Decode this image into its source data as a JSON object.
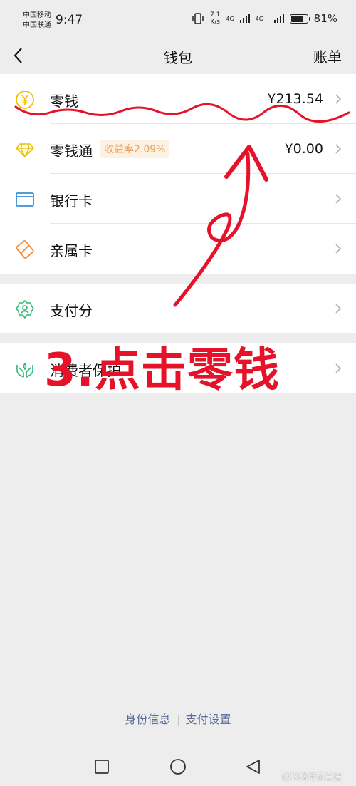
{
  "status_bar": {
    "carrier1": "中国移动",
    "carrier2": "中国联通",
    "time": "9:47",
    "speed_value": "7.1",
    "speed_unit": "K/s",
    "net1": "4G",
    "net2": "4G+",
    "battery": "81%",
    "battery_level": 0.81
  },
  "nav": {
    "back_icon": "chevron-left-icon",
    "title": "钱包",
    "right": "账单"
  },
  "groups": [
    {
      "items": [
        {
          "label": "零钱",
          "value": "¥213.54",
          "icon": "yuan-coin-icon"
        },
        {
          "label": "零钱通",
          "badge": "收益率2.09%",
          "value": "¥0.00",
          "icon": "diamond-icon"
        },
        {
          "label": "银行卡",
          "icon": "bank-card-icon"
        },
        {
          "label": "亲属卡",
          "icon": "family-card-icon"
        }
      ]
    },
    {
      "items": [
        {
          "label": "支付分",
          "icon": "badge-person-icon"
        }
      ]
    },
    {
      "items": [
        {
          "label": "消费者保护",
          "icon": "hands-protect-icon"
        }
      ]
    }
  ],
  "annotation": {
    "text": "3.点击零钱",
    "color": "#e5122a"
  },
  "footer": {
    "link1": "身份信息",
    "link2": "支付设置"
  },
  "watermark": "@枫林侍茶言语",
  "colors": {
    "background": "#ededed",
    "link": "#576b95",
    "badge_bg": "#fdf1e3",
    "badge_text": "#e8a25a"
  }
}
